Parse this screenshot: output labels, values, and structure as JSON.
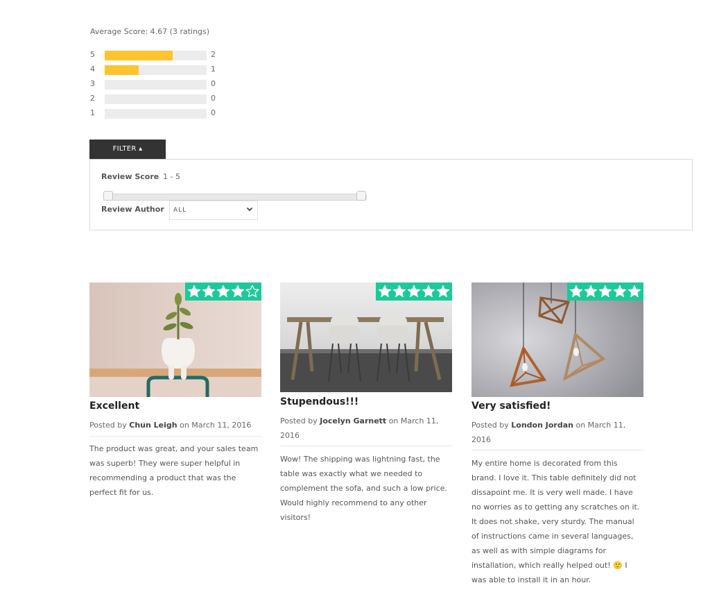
{
  "summary": {
    "average_label": "Average Score: 4.67 (3 ratings)",
    "bars": [
      {
        "star": "5",
        "count": "2",
        "fraction": 0.667
      },
      {
        "star": "4",
        "count": "1",
        "fraction": 0.333
      },
      {
        "star": "3",
        "count": "0",
        "fraction": 0
      },
      {
        "star": "2",
        "count": "0",
        "fraction": 0
      },
      {
        "star": "1",
        "count": "0",
        "fraction": 0
      }
    ],
    "bar_fill_color": "#fec42d"
  },
  "filter": {
    "tab_label": "FILTER ▴",
    "score_label": "Review Score",
    "score_range": "1 - 5",
    "score_min": 1,
    "score_max": 5,
    "author_label": "Review Author",
    "author_selected": "ALL"
  },
  "reviews": [
    {
      "rating": 4,
      "title": "Excellent",
      "posted_prefix": "Posted by",
      "author": "Chun Leigh",
      "posted_suffix": "on March 11, 2016",
      "body": "The product was great, and your sales team was superb! They were super helpful in recommending a product that was the perfect fit for us."
    },
    {
      "rating": 5,
      "title": "Stupendous!!!",
      "posted_prefix": "Posted by",
      "author": "Jocelyn Garnett",
      "posted_suffix": "on March 11, 2016",
      "body": "Wow! The shipping was lightning fast, the table was exactly what we needed to complement the sofa, and such a low price. Would highly recommend to any other visitors!"
    },
    {
      "rating": 5,
      "title": "Very satisfied!",
      "posted_prefix": "Posted by",
      "author": "London Jordan",
      "posted_suffix": "on March 11, 2016",
      "body": "My entire home is decorated from this brand. I love it. This table definitely did not dissapoint me. It is very well made. I have no worries as to getting any scratches on it. It does not shake, very sturdy. The manual of instructions came in several languages, as well as with simple diagrams for installation, which really helped out! 🙂 I was able to install it in an hour."
    }
  ],
  "colors": {
    "badge": "#1dc998",
    "filter_tab": "#333333"
  }
}
